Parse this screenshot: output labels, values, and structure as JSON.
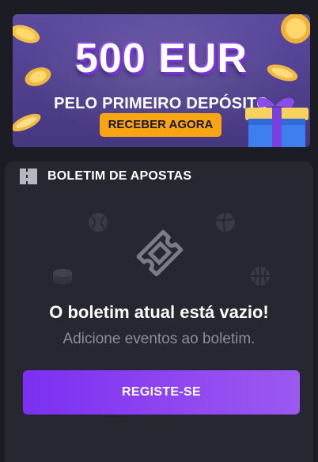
{
  "banner": {
    "amount": "500 EUR",
    "subtitle": "PELO PRIMEIRO DEPÓSITO",
    "cta_label": "RECEBER AGORA"
  },
  "betslip": {
    "title": "BOLETIM DE APOSTAS",
    "empty_title": "O boletim atual está vazio!",
    "empty_subtitle": "Adicione eventos ao boletim.",
    "register_label": "REGISTE-SE"
  },
  "colors": {
    "background": "#1c1c24",
    "panel": "#272731",
    "banner": "#4f3f8d",
    "cta": "#f7a513",
    "accent": "#8f46f0"
  }
}
